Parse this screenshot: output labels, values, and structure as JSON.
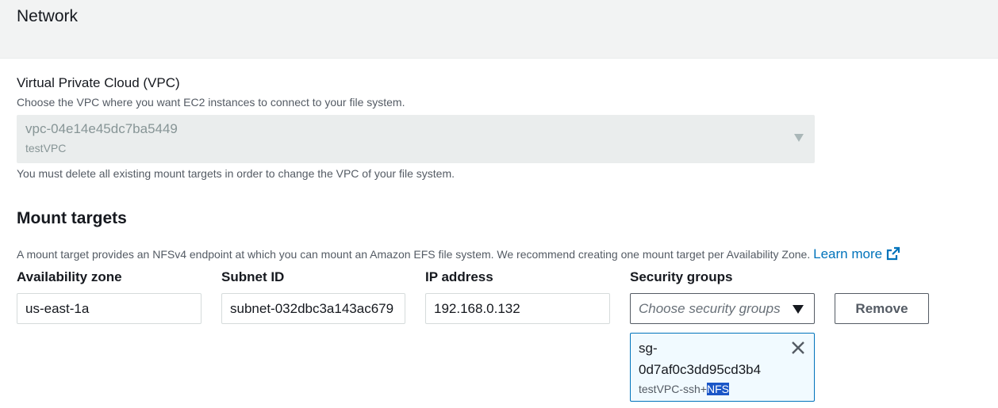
{
  "section": {
    "title": "Network"
  },
  "vpc": {
    "label": "Virtual Private Cloud (VPC)",
    "description": "Choose the VPC where you want EC2 instances to connect to your file system.",
    "selected_value": "vpc-04e14e45dc7ba5449",
    "selected_sub": "testVPC",
    "note": "You must delete all existing mount targets in order to change the VPC of your file system.",
    "icon": "caret-down-icon"
  },
  "mount_targets": {
    "title": "Mount targets",
    "description": "A mount target provides an NFSv4 endpoint at which you can mount an Amazon EFS file system. We recommend creating one mount target per Availability Zone.",
    "learn_more": "Learn more",
    "learn_more_icon": "external-link-icon",
    "columns": {
      "az": "Availability zone",
      "subnet": "Subnet ID",
      "ip": "IP address",
      "sg": "Security groups"
    },
    "rows": [
      {
        "az": "us-east-1a",
        "subnet": "subnet-032dbc3a143ac679",
        "ip": "192.168.0.132",
        "sg_placeholder": "Choose security groups",
        "remove_label": "Remove",
        "tokens": [
          {
            "id_line1": "sg-",
            "id_line2": "0d7af0c3dd95cd3b4",
            "name_prefix": "testVPC-ssh+",
            "name_highlight": "NFS"
          }
        ]
      }
    ]
  },
  "colors": {
    "link": "#0073bb",
    "token_bg": "#f1faff",
    "token_border": "#0073bb",
    "selection": "#1a56c7"
  }
}
